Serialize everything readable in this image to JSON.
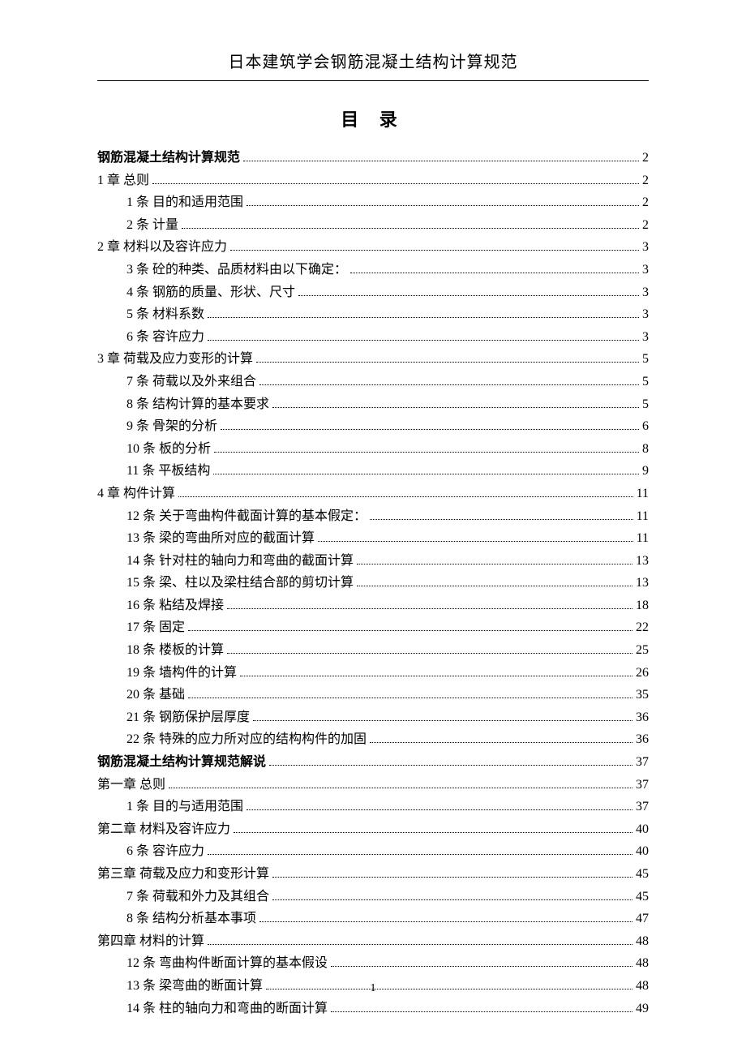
{
  "header_title": "日本建筑学会钢筋混凝土结构计算规范",
  "toc_heading": "目 录",
  "page_number": "1",
  "toc": [
    {
      "level": 1,
      "bold": true,
      "label": "钢筋混凝土结构计算规范 ",
      "page": "2"
    },
    {
      "level": 1,
      "bold": false,
      "label": "1 章  总则",
      "page": "2"
    },
    {
      "level": 2,
      "bold": false,
      "label": "1 条 目的和适用范围",
      "page": "2"
    },
    {
      "level": 2,
      "bold": false,
      "label": "2 条 计量",
      "page": "2"
    },
    {
      "level": 1,
      "bold": false,
      "label": "2 章   材料以及容许应力",
      "page": "3"
    },
    {
      "level": 2,
      "bold": false,
      "label": "3 条 砼的种类、品质材料由以下确定：",
      "page": "3"
    },
    {
      "level": 2,
      "bold": false,
      "label": "4 条 钢筋的质量、形状、尺寸",
      "page": "3"
    },
    {
      "level": 2,
      "bold": false,
      "label": "5 条 材料系数",
      "page": "3"
    },
    {
      "level": 2,
      "bold": false,
      "label": "6 条 容许应力",
      "page": "3"
    },
    {
      "level": 1,
      "bold": false,
      "label": "3 章 荷载及应力变形的计算",
      "page": "5"
    },
    {
      "level": 2,
      "bold": false,
      "label": "7 条 荷载以及外来组合",
      "page": "5"
    },
    {
      "level": 2,
      "bold": false,
      "label": "8 条 结构计算的基本要求",
      "page": "5"
    },
    {
      "level": 2,
      "bold": false,
      "label": "9 条 骨架的分析",
      "page": "6"
    },
    {
      "level": 2,
      "bold": false,
      "label": "10 条 板的分析",
      "page": "8"
    },
    {
      "level": 2,
      "bold": false,
      "label": "11 条 平板结构",
      "page": "9"
    },
    {
      "level": 1,
      "bold": false,
      "label": "4 章 构件计算",
      "page": "11"
    },
    {
      "level": 2,
      "bold": false,
      "label": "12 条   关于弯曲构件截面计算的基本假定：",
      "page": "11"
    },
    {
      "level": 2,
      "bold": false,
      "label": "13 条 梁的弯曲所对应的截面计算",
      "page": "11"
    },
    {
      "level": 2,
      "bold": false,
      "label": "14 条 针对柱的轴向力和弯曲的截面计算",
      "page": "13"
    },
    {
      "level": 2,
      "bold": false,
      "label": "15 条 梁、柱以及梁柱结合部的剪切计算",
      "page": "13"
    },
    {
      "level": 2,
      "bold": false,
      "label": "16 条 粘结及焊接",
      "page": "18"
    },
    {
      "level": 2,
      "bold": false,
      "label": "17 条 固定",
      "page": "22"
    },
    {
      "level": 2,
      "bold": false,
      "label": "18 条 楼板的计算",
      "page": "25"
    },
    {
      "level": 2,
      "bold": false,
      "label": "19 条 墙构件的计算",
      "page": "26"
    },
    {
      "level": 2,
      "bold": false,
      "label": "20 条 基础",
      "page": "35"
    },
    {
      "level": 2,
      "bold": false,
      "label": "21 条 钢筋保护层厚度",
      "page": "36"
    },
    {
      "level": 2,
      "bold": false,
      "label": "22 条 特殊的应力所对应的结构构件的加固",
      "page": "36"
    },
    {
      "level": 1,
      "bold": true,
      "label": "钢筋混凝土结构计算规范解说 ",
      "page": "37"
    },
    {
      "level": 1,
      "bold": false,
      "label": "第一章   总则",
      "page": "37"
    },
    {
      "level": 2,
      "bold": false,
      "label": "1 条 目的与适用范围",
      "page": "37"
    },
    {
      "level": 1,
      "bold": false,
      "label": "第二章   材料及容许应力",
      "page": "40"
    },
    {
      "level": 2,
      "bold": false,
      "label": "6 条 容许应力",
      "page": "40"
    },
    {
      "level": 1,
      "bold": false,
      "label": "第三章   荷载及应力和变形计算",
      "page": "45"
    },
    {
      "level": 2,
      "bold": false,
      "label": "7 条 荷载和外力及其组合",
      "page": "45"
    },
    {
      "level": 2,
      "bold": false,
      "label": "8 条 结构分析基本事项",
      "page": "47"
    },
    {
      "level": 1,
      "bold": false,
      "label": "第四章 材料的计算",
      "page": "48"
    },
    {
      "level": 2,
      "bold": false,
      "label": "12 条 弯曲构件断面计算的基本假设",
      "page": "48"
    },
    {
      "level": 2,
      "bold": false,
      "label": "13 条 梁弯曲的断面计算",
      "page": "48"
    },
    {
      "level": 2,
      "bold": false,
      "label": "14 条 柱的轴向力和弯曲的断面计算",
      "page": "49"
    }
  ]
}
